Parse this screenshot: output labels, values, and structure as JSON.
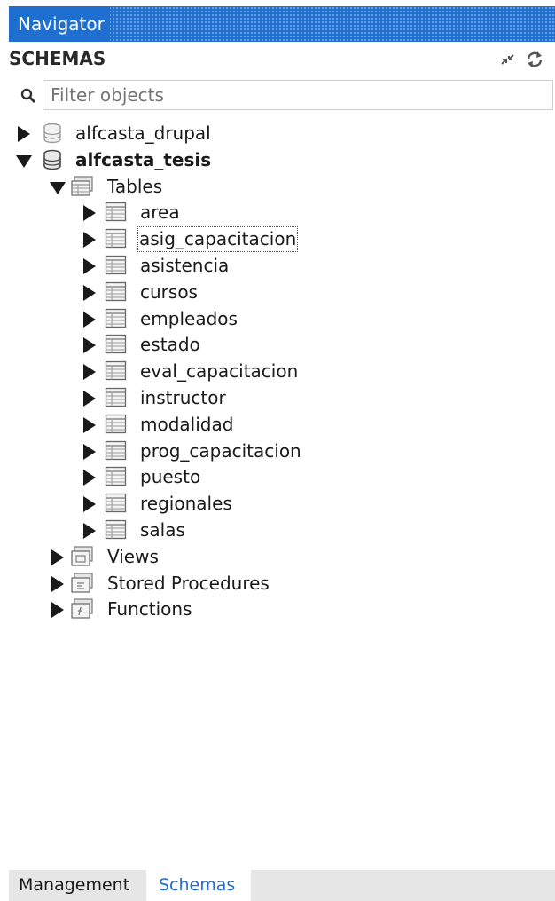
{
  "navigator": {
    "title": "Navigator"
  },
  "schemas_header": {
    "label": "SCHEMAS",
    "collapse_icon": "collapse-all-icon",
    "refresh_icon": "refresh-icon"
  },
  "filter": {
    "placeholder": "Filter objects",
    "icon": "search-icon"
  },
  "tree": {
    "schemas": [
      {
        "name": "alfcasta_drupal",
        "expanded": false,
        "icon": "database-icon"
      },
      {
        "name": "alfcasta_tesis",
        "expanded": true,
        "active": true,
        "icon": "database-icon",
        "tables_group": {
          "label": "Tables",
          "expanded": true,
          "icon": "folder-table-icon",
          "items": [
            "area",
            "asig_capacitacion",
            "asistencia",
            "cursos",
            "empleados",
            "estado",
            "eval_capacitacion",
            "instructor",
            "modalidad",
            "prog_capacitacion",
            "puesto",
            "regionales",
            "salas"
          ],
          "focused_item": "asig_capacitacion"
        },
        "groups": [
          {
            "label": "Views",
            "expanded": false,
            "icon": "folder-view-icon"
          },
          {
            "label": "Stored Procedures",
            "expanded": false,
            "icon": "folder-procedure-icon"
          },
          {
            "label": "Functions",
            "expanded": false,
            "icon": "folder-function-icon"
          }
        ]
      }
    ]
  },
  "tabs": [
    {
      "label": "Management",
      "active": false
    },
    {
      "label": "Schemas",
      "active": true
    }
  ],
  "colors": {
    "accent": "#1f6fd1",
    "tab_bar": "#e6e6e6"
  }
}
